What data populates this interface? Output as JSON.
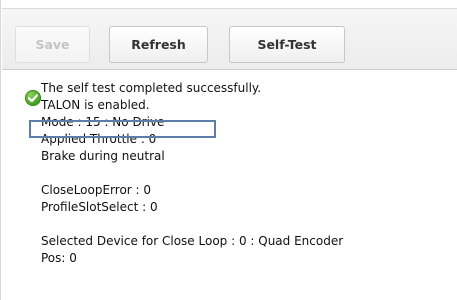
{
  "toolbar": {
    "save_label": "Save",
    "refresh_label": "Refresh",
    "selftest_label": "Self-Test"
  },
  "status": {
    "icon": "check-circle-icon",
    "color": "#4caf2a"
  },
  "report": {
    "line1": "The self test completed successfully.",
    "line2": "TALON is enabled.",
    "line3": "Mode : 15 : No Drive",
    "line4": "Applied Throttle : 0",
    "line5": "Brake during neutral",
    "line6": "CloseLoopError : 0",
    "line7": "ProfileSlotSelect : 0",
    "line8": "Selected Device for Close Loop : 0 : Quad Encoder",
    "line9": "Pos: 0"
  },
  "highlight": {
    "color": "#5b7fa9"
  }
}
